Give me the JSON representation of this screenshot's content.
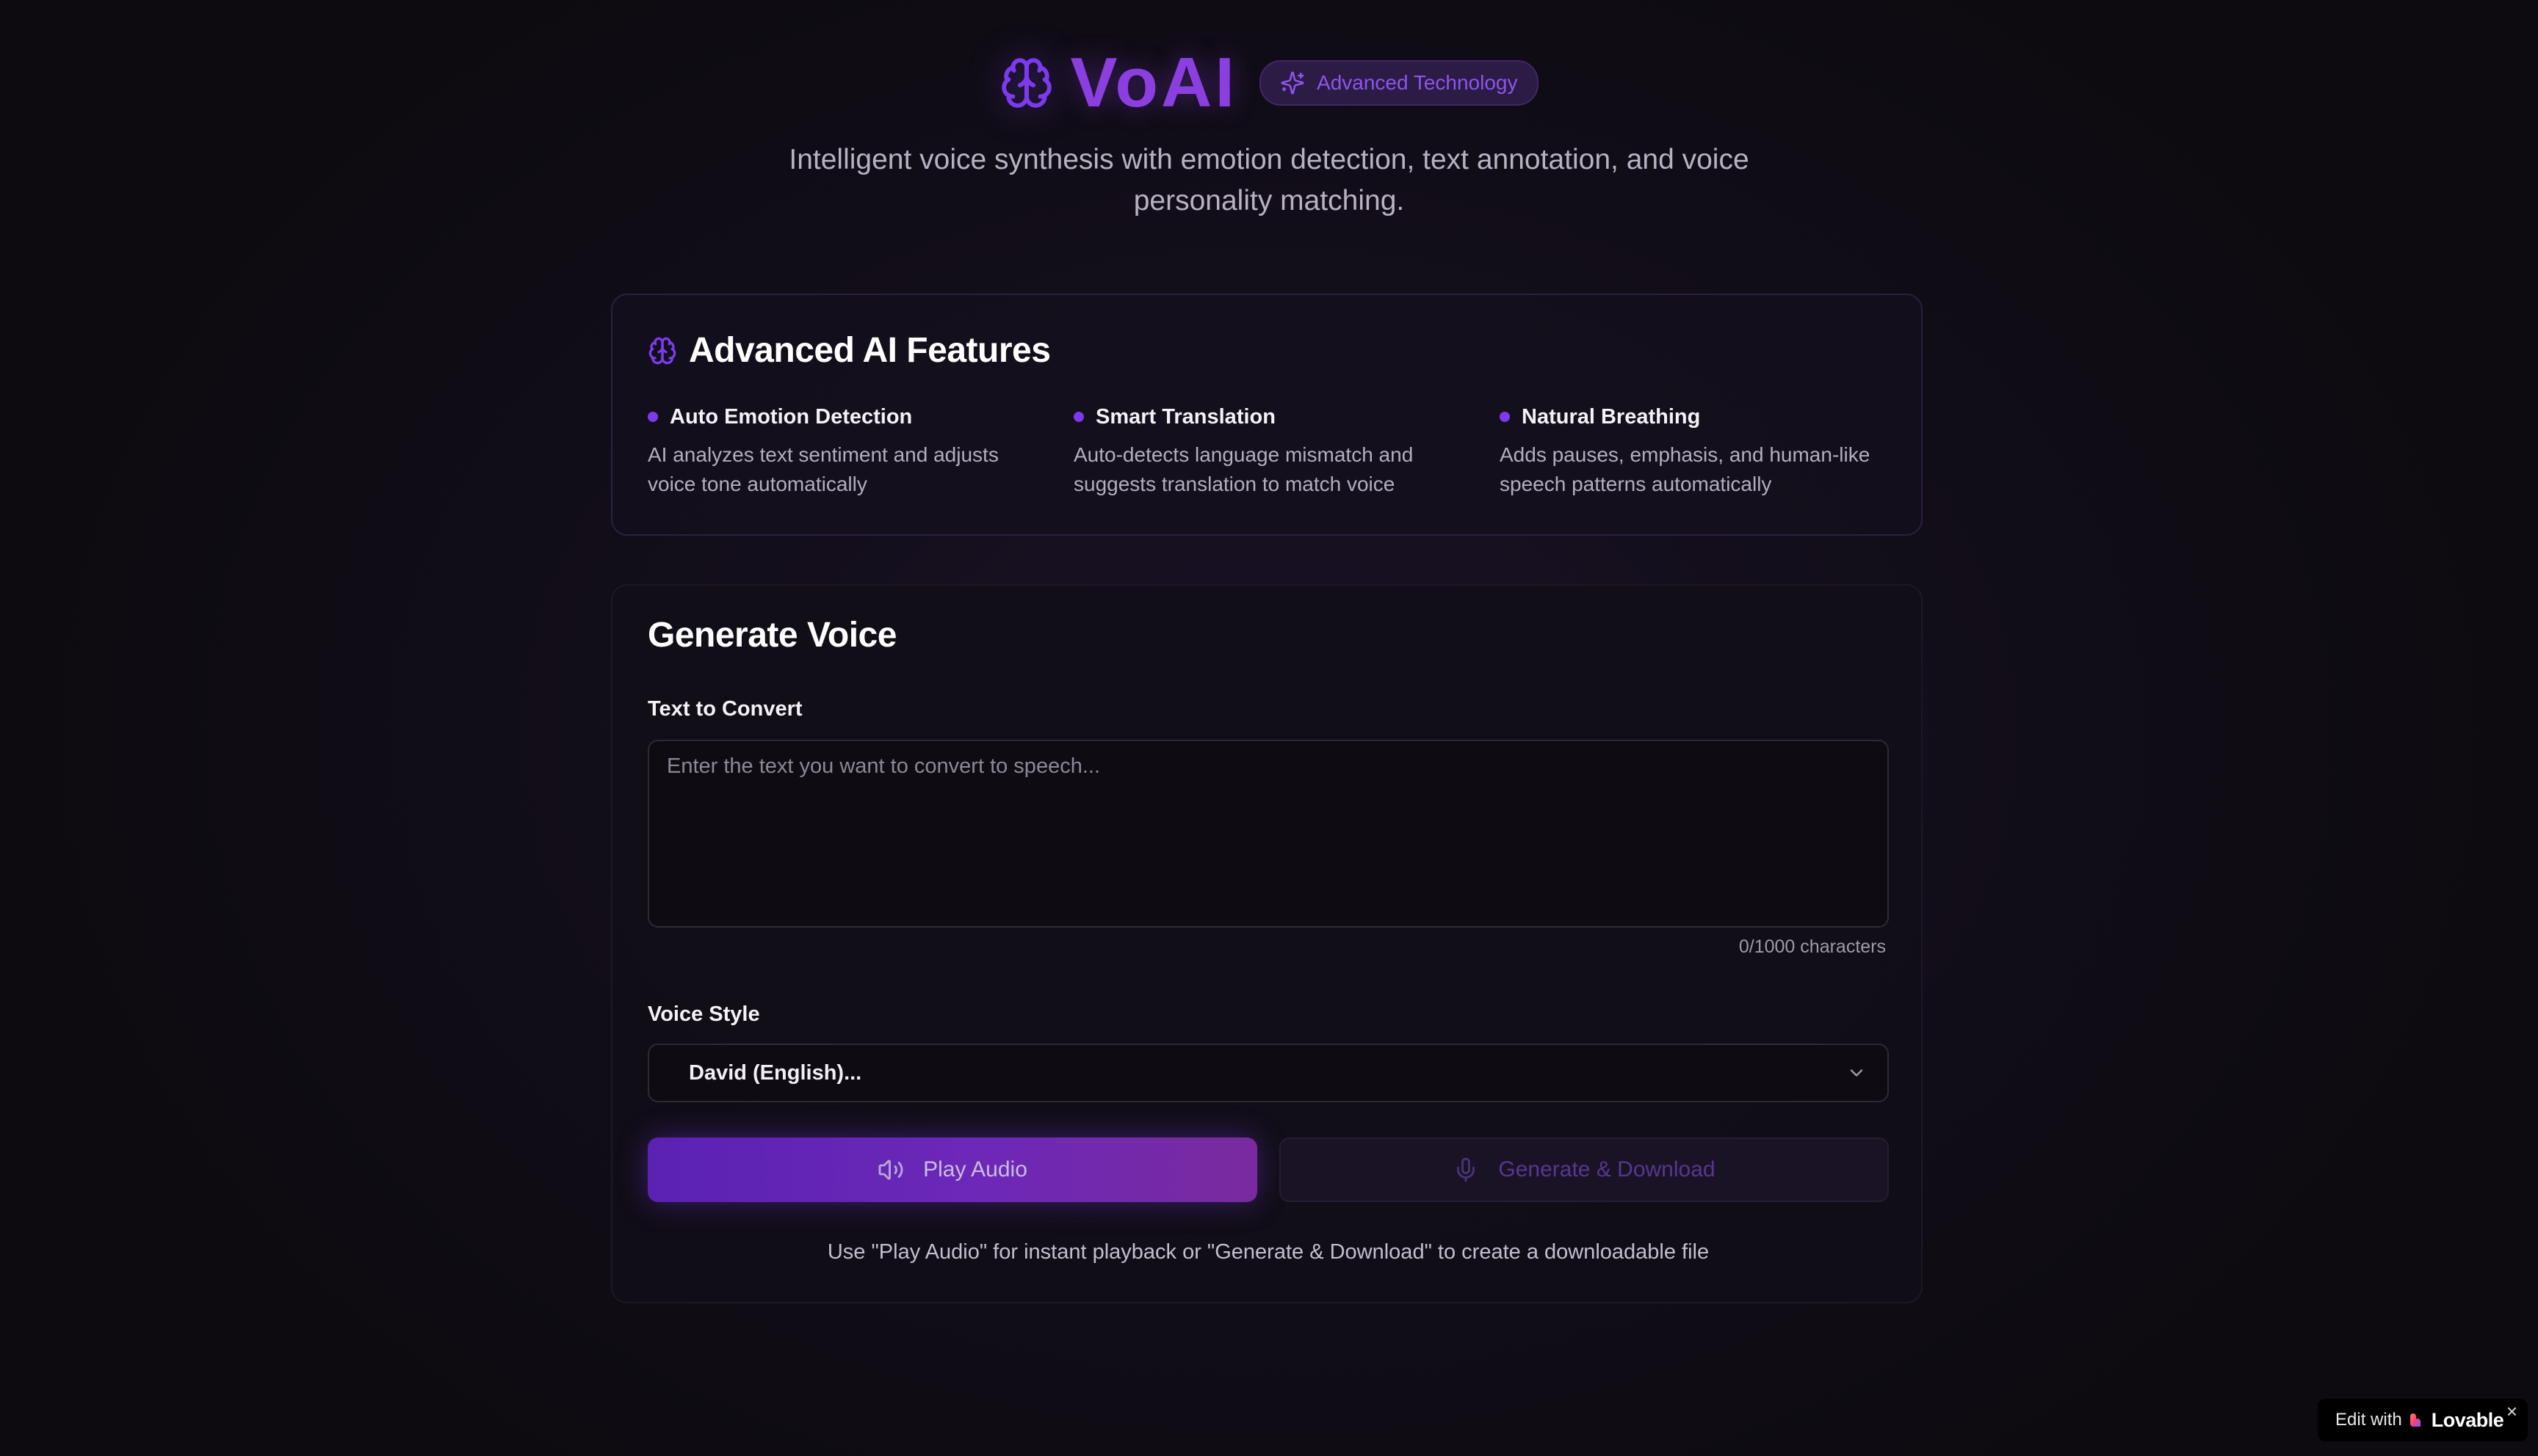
{
  "brand": {
    "name": "VoAI",
    "badge_label": "Advanced Technology",
    "tagline": "Intelligent voice synthesis with emotion detection, text annotation, and voice personality matching.",
    "accent_color": "#8b3fe0",
    "icon": "brain-icon",
    "badge_icon": "sparkles-icon"
  },
  "features": {
    "title": "Advanced AI Features",
    "icon": "brain-icon",
    "items": [
      {
        "title": "Auto Emotion Detection",
        "description": "AI analyzes text sentiment and adjusts voice tone automatically"
      },
      {
        "title": "Smart Translation",
        "description": "Auto-detects language mismatch and suggests translation to match voice"
      },
      {
        "title": "Natural Breathing",
        "description": "Adds pauses, emphasis, and human-like speech patterns automatically"
      }
    ]
  },
  "generate": {
    "title": "Generate Voice",
    "text_label": "Text to Convert",
    "text_value": "",
    "text_placeholder": "Enter the text you want to convert to speech...",
    "char_count": "0/1000 characters",
    "voice_label": "Voice Style",
    "voice_selected": "David (English)...",
    "play_button": "Play Audio",
    "play_icon": "speaker-icon",
    "download_button": "Generate & Download",
    "download_icon": "microphone-icon",
    "hint": "Use \"Play Audio\" for instant playback or \"Generate & Download\" to create a downloadable file"
  },
  "lovable": {
    "edit_label": "Edit with",
    "brand": "Lovable",
    "close": "×"
  }
}
